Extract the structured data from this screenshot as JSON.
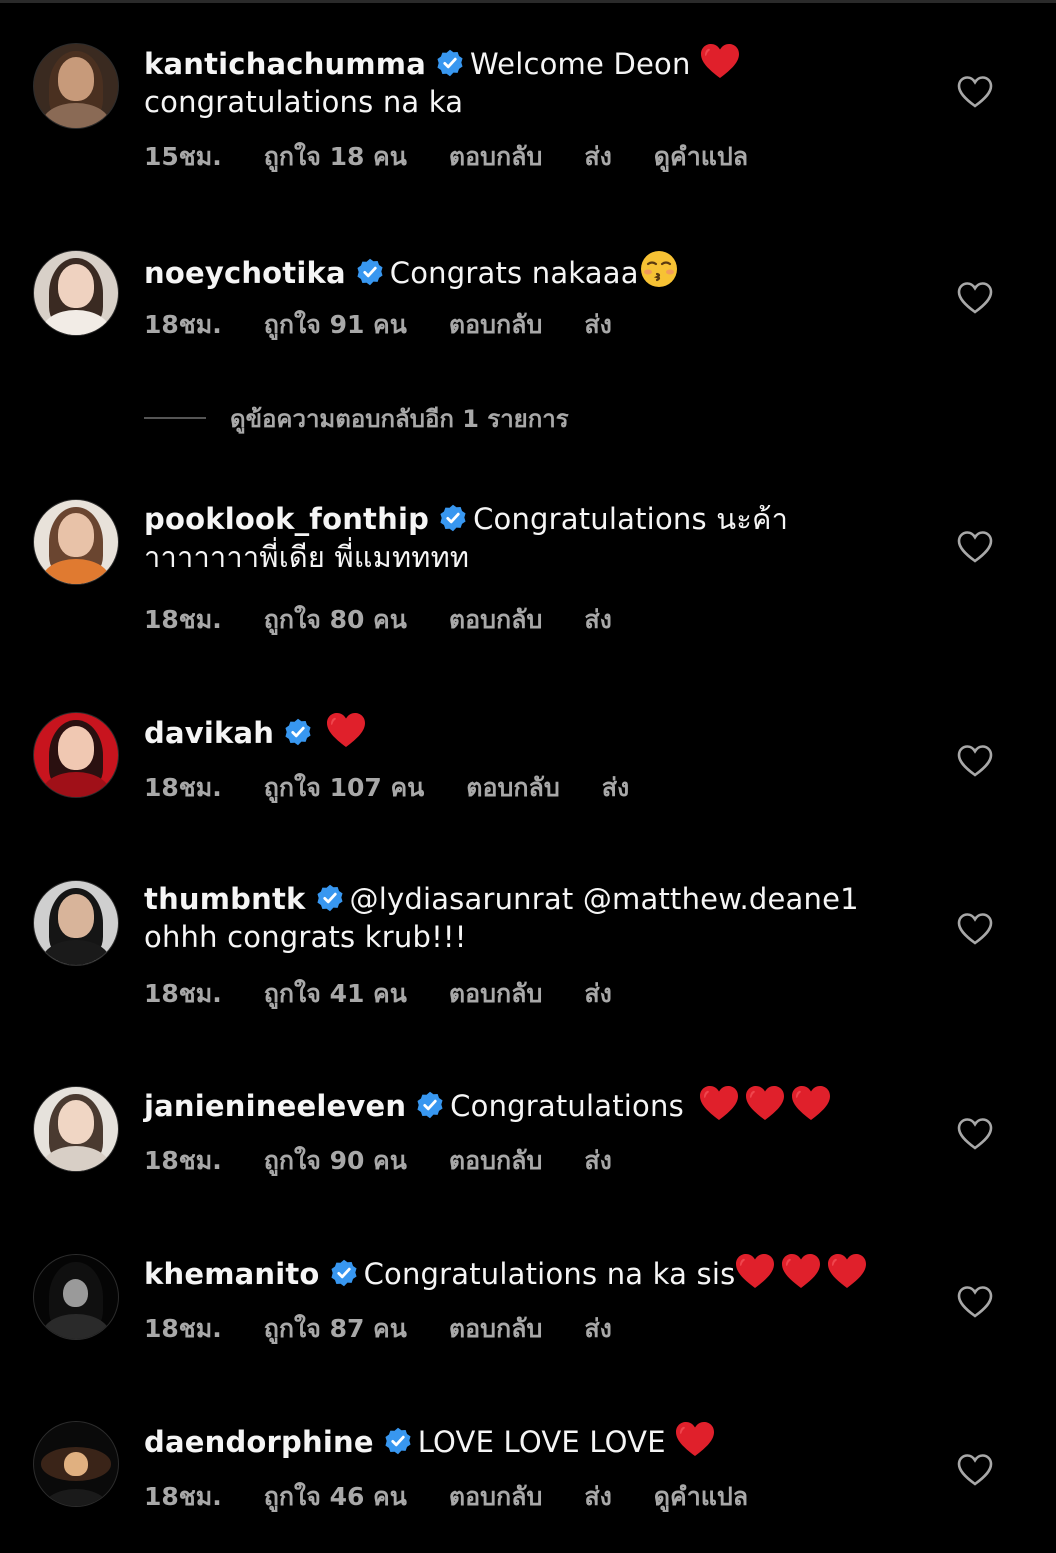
{
  "comments": [
    {
      "username": "kantichachumma",
      "text": "Welcome Deon ",
      "emoji_after": [
        "red-heart"
      ],
      "line2": "congratulations na ka",
      "time": "15ชม.",
      "likes": "ถูกใจ 18 คน",
      "reply": "ตอบกลับ",
      "send": "ส่ง",
      "translate": "ดูคำแปล"
    },
    {
      "username": "noeychotika",
      "text": "Congrats nakaaa",
      "emoji_after": [
        "kissing-face"
      ],
      "line2": "",
      "time": "18ชม.",
      "likes": "ถูกใจ 91 คน",
      "reply": "ตอบกลับ",
      "send": "ส่ง",
      "translate": ""
    },
    {
      "username": "pooklook_fonthip",
      "text": "Congratulations นะค้า",
      "emoji_after": [],
      "line2": "าาาาาาาพี่เดีย พี่แมทททท",
      "time": "18ชม.",
      "likes": "ถูกใจ 80 คน",
      "reply": "ตอบกลับ",
      "send": "ส่ง",
      "translate": ""
    },
    {
      "username": "davikah",
      "text": "",
      "emoji_after": [
        "red-heart"
      ],
      "line2": "",
      "time": "18ชม.",
      "likes": "ถูกใจ 107 คน",
      "reply": "ตอบกลับ",
      "send": "ส่ง",
      "translate": ""
    },
    {
      "username": "thumbntk",
      "text": "@lydiasarunrat @matthew.deane1",
      "emoji_after": [],
      "line2": "ohhh congrats krub!!!",
      "time": "18ชม.",
      "likes": "ถูกใจ 41 คน",
      "reply": "ตอบกลับ",
      "send": "ส่ง",
      "translate": ""
    },
    {
      "username": "janienineeleven",
      "text": "Congratulations ",
      "emoji_after": [
        "red-heart",
        "red-heart",
        "red-heart"
      ],
      "line2": "",
      "time": "18ชม.",
      "likes": "ถูกใจ 90 คน",
      "reply": "ตอบกลับ",
      "send": "ส่ง",
      "translate": ""
    },
    {
      "username": "khemanito",
      "text": "Congratulations na ka sis",
      "emoji_after": [
        "red-heart",
        "red-heart",
        "red-heart"
      ],
      "line2": "",
      "time": "18ชม.",
      "likes": "ถูกใจ 87 คน",
      "reply": "ตอบกลับ",
      "send": "ส่ง",
      "translate": ""
    },
    {
      "username": "daendorphine",
      "text": "LOVE LOVE LOVE ",
      "emoji_after": [
        "red-heart"
      ],
      "line2": "",
      "time": "18ชม.",
      "likes": "ถูกใจ 46 คน",
      "reply": "ตอบกลับ",
      "send": "ส่ง",
      "translate": "ดูคำแปล"
    }
  ],
  "view_more_replies": "ดูข้อความตอบกลับอีก 1 รายการ",
  "colors": {
    "background": "#000000",
    "text": "#f5f5f5",
    "meta": "#a8a8a8",
    "verified": "#3897f0",
    "emoji_heart": "#e0202b"
  },
  "icons": {
    "verified": "verified-badge-icon",
    "like": "heart-outline-icon",
    "red-heart": "red-heart-emoji",
    "kissing-face": "kissing-face-emoji"
  }
}
